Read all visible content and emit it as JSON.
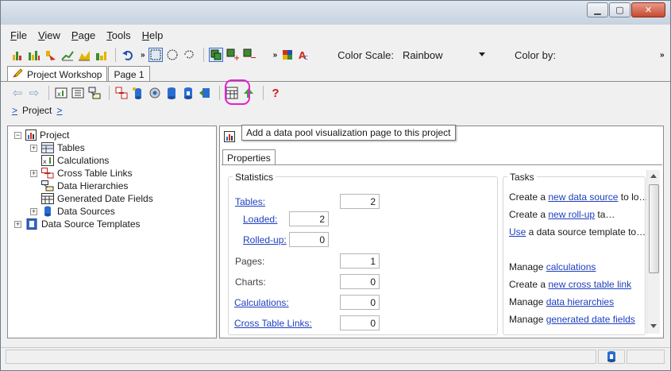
{
  "menu": [
    "File",
    "View",
    "Page",
    "Tools",
    "Help"
  ],
  "toolbar": {
    "color_scale_label": "Color Scale:",
    "color_scale_value": "Rainbow",
    "color_by_label": "Color by:"
  },
  "tabs": [
    {
      "label": "Project Workshop",
      "active": true
    },
    {
      "label": "Page 1",
      "active": false
    }
  ],
  "breadcrumb": {
    "label": "Project",
    "arrow": ">"
  },
  "tooltip": "Add a data pool visualization page to this project",
  "tree": [
    {
      "label": "Project",
      "icon": "project-icon",
      "expander": "−"
    },
    {
      "label": "Tables",
      "icon": "tables-icon",
      "expander": "+"
    },
    {
      "label": "Calculations",
      "icon": "calculations-icon",
      "expander": ""
    },
    {
      "label": "Cross Table Links",
      "icon": "cross-table-links-icon",
      "expander": "+"
    },
    {
      "label": "Data Hierarchies",
      "icon": "data-hierarchies-icon",
      "expander": ""
    },
    {
      "label": "Generated Date Fields",
      "icon": "generated-date-fields-icon",
      "expander": ""
    },
    {
      "label": "Data Sources",
      "icon": "data-sources-icon",
      "expander": "+"
    },
    {
      "label": "Data Source Templates",
      "icon": "data-source-templates-icon",
      "expander": "+"
    }
  ],
  "properties_tab": "Properties",
  "statistics": {
    "title": "Statistics",
    "tables_label": "Tables:",
    "tables_value": "2",
    "loaded_label": "Loaded:",
    "loaded_value": "2",
    "rolled_up_label": "Rolled-up:",
    "rolled_up_value": "0",
    "pages_label": "Pages:",
    "pages_value": "1",
    "charts_label": "Charts:",
    "charts_value": "0",
    "calculations_label": "Calculations:",
    "calculations_value": "0",
    "cross_table_links_label": "Cross Table Links:",
    "cross_table_links_value": "0"
  },
  "tasks": {
    "title": "Tasks",
    "items": [
      {
        "pre": "Create a ",
        "link": "new data source",
        "post": " to lo…"
      },
      {
        "pre": "Create a ",
        "link": "new roll-up",
        "post": " ta…"
      },
      {
        "pre": "",
        "link": "Use",
        "post": " a data source template to…"
      },
      {
        "pre": "Manage ",
        "link": "calculations",
        "post": ""
      },
      {
        "pre": "Create a ",
        "link": "new cross table link",
        "post": ""
      },
      {
        "pre": "Manage ",
        "link": "data hierarchies",
        "post": ""
      },
      {
        "pre": "Manage ",
        "link": "generated date fields",
        "post": ""
      }
    ]
  },
  "colors": {
    "highlight": "#e31fd0",
    "link": "#1f3fbf"
  }
}
